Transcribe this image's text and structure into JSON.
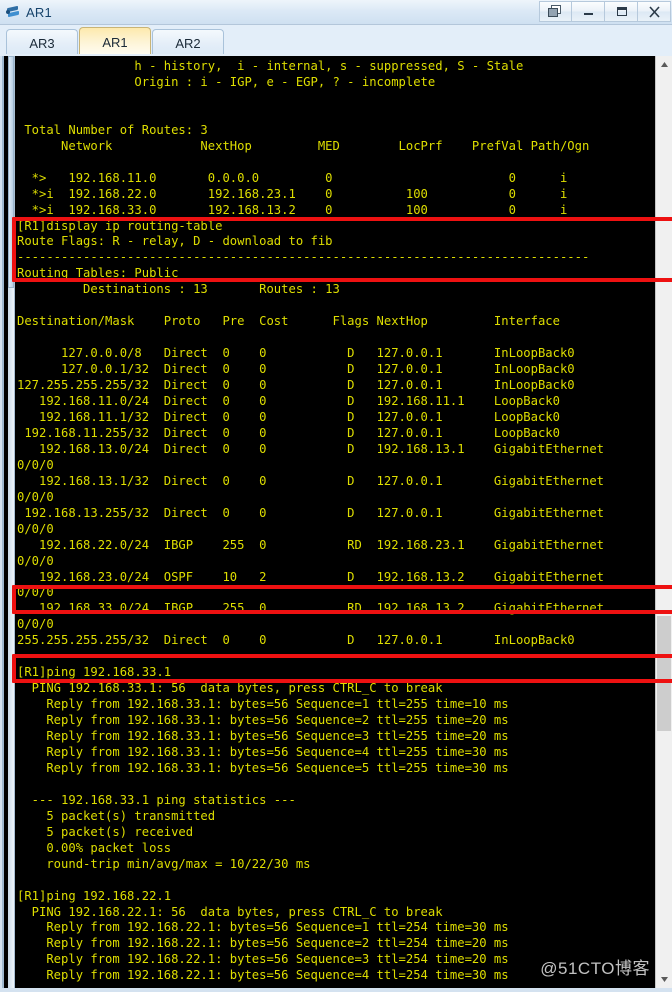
{
  "window": {
    "title": "AR1",
    "app_icon": "router-icon",
    "buttons": [
      {
        "name": "restore-all-button",
        "label": "",
        "icon": "cascade-windows-icon"
      },
      {
        "name": "minimize-button",
        "label": "–",
        "icon": "minimize-icon"
      },
      {
        "name": "maximize-button",
        "label": "",
        "icon": "maximize-icon"
      },
      {
        "name": "close-button",
        "label": "X",
        "icon": "close-icon"
      }
    ]
  },
  "tabs": [
    {
      "label": "AR3",
      "active": false
    },
    {
      "label": "AR1",
      "active": true
    },
    {
      "label": "AR2",
      "active": false
    }
  ],
  "terminal": {
    "foreground_color": "#dede00",
    "background_color": "#000000",
    "text": "                h - history,  i - internal, s - suppressed, S - Stale\n                Origin : i - IGP, e - EGP, ? - incomplete\n\n\n Total Number of Routes: 3\n      Network            NextHop         MED        LocPrf    PrefVal Path/Ogn\n\n  *>   192.168.11.0       0.0.0.0         0                        0      i\n  *>i  192.168.22.0       192.168.23.1    0          100           0      i\n  *>i  192.168.33.0       192.168.13.2    0          100           0      i\n[R1]display ip routing-table\nRoute Flags: R - relay, D - download to fib\n------------------------------------------------------------------------------\nRouting Tables: Public\n         Destinations : 13       Routes : 13\n\nDestination/Mask    Proto   Pre  Cost      Flags NextHop         Interface\n\n      127.0.0.0/8   Direct  0    0           D   127.0.0.1       InLoopBack0\n      127.0.0.1/32  Direct  0    0           D   127.0.0.1       InLoopBack0\n127.255.255.255/32  Direct  0    0           D   127.0.0.1       InLoopBack0\n   192.168.11.0/24  Direct  0    0           D   192.168.11.1    LoopBack0\n   192.168.11.1/32  Direct  0    0           D   127.0.0.1       LoopBack0\n 192.168.11.255/32  Direct  0    0           D   127.0.0.1       LoopBack0\n   192.168.13.0/24  Direct  0    0           D   192.168.13.1    GigabitEthernet\n0/0/0\n   192.168.13.1/32  Direct  0    0           D   127.0.0.1       GigabitEthernet\n0/0/0\n 192.168.13.255/32  Direct  0    0           D   127.0.0.1       GigabitEthernet\n0/0/0\n   192.168.22.0/24  IBGP    255  0           RD  192.168.23.1    GigabitEthernet\n0/0/0\n   192.168.23.0/24  OSPF    10   2           D   192.168.13.2    GigabitEthernet\n0/0/0\n   192.168.33.0/24  IBGP    255  0           RD  192.168.13.2    GigabitEthernet\n0/0/0\n255.255.255.255/32  Direct  0    0           D   127.0.0.1       InLoopBack0\n\n[R1]ping 192.168.33.1\n  PING 192.168.33.1: 56  data bytes, press CTRL_C to break\n    Reply from 192.168.33.1: bytes=56 Sequence=1 ttl=255 time=10 ms\n    Reply from 192.168.33.1: bytes=56 Sequence=2 ttl=255 time=20 ms\n    Reply from 192.168.33.1: bytes=56 Sequence=3 ttl=255 time=20 ms\n    Reply from 192.168.33.1: bytes=56 Sequence=4 ttl=255 time=30 ms\n    Reply from 192.168.33.1: bytes=56 Sequence=5 ttl=255 time=30 ms\n\n  --- 192.168.33.1 ping statistics ---\n    5 packet(s) transmitted\n    5 packet(s) received\n    0.00% packet loss\n    round-trip min/avg/max = 10/22/30 ms\n\n[R1]ping 192.168.22.1\n  PING 192.168.22.1: 56  data bytes, press CTRL_C to break\n    Reply from 192.168.22.1: bytes=56 Sequence=1 ttl=254 time=30 ms\n    Reply from 192.168.22.1: bytes=56 Sequence=2 ttl=254 time=20 ms\n    Reply from 192.168.22.1: bytes=56 Sequence=3 ttl=254 time=20 ms\n    Reply from 192.168.22.1: bytes=56 Sequence=4 ttl=254 time=30 ms"
  },
  "annotations": {
    "highlight_color": "#ee1111",
    "boxes": [
      {
        "name": "bgp-routes-highlight",
        "description": "BGP routing table entries"
      },
      {
        "name": "ibgp-route-22-highlight",
        "description": "192.168.22.0/24 IBGP route"
      },
      {
        "name": "ibgp-route-33-highlight",
        "description": "192.168.33.0/24 IBGP route"
      }
    ]
  },
  "watermark": {
    "text": "@51CTO博客"
  }
}
